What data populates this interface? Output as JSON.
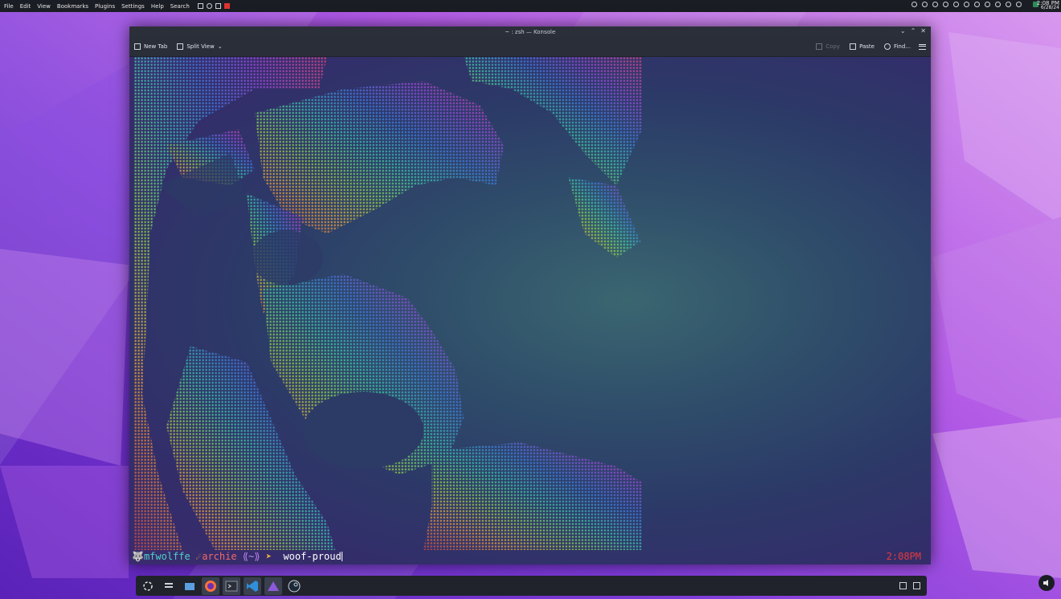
{
  "top_panel": {
    "menu": [
      "File",
      "Edit",
      "View",
      "Bookmarks",
      "Plugins",
      "Settings",
      "Help",
      "Search"
    ],
    "clock_time": "2:08 PM",
    "clock_date": "6/28/24"
  },
  "window": {
    "title": "~ : zsh — Konsole"
  },
  "toolbar": {
    "new_tab": "New Tab",
    "split_view": "Split View",
    "copy": "Copy",
    "paste": "Paste",
    "find": "Find..."
  },
  "prompt": {
    "user": "mfwolffe",
    "host": "archie",
    "dir": "⟪~⟫",
    "command": "woof-proud",
    "right_time": "2:08PM"
  },
  "colors": {
    "prompt_user": "#4fd1c5",
    "prompt_host": "#ee6a6a",
    "prompt_dir": "#c389f0",
    "prompt_arrow": "#f0b040",
    "right_time": "#e23b3b"
  },
  "taskbar": {
    "apps": [
      "app-launcher-icon",
      "pager-icon",
      "file-manager-icon",
      "firefox-icon",
      "konsole-icon",
      "vscode-icon",
      "vectorizer-icon",
      "steam-icon"
    ]
  }
}
